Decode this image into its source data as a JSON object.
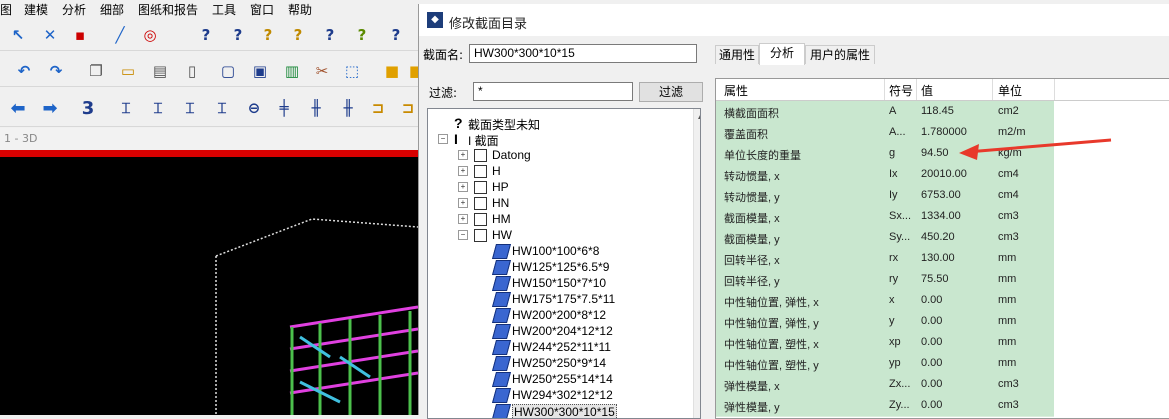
{
  "app": {
    "menu": [
      "图",
      "建模",
      "分析",
      "细部",
      "图纸和报告",
      "工具",
      "窗口",
      "帮助"
    ],
    "viewport_title": "1 - 3D"
  },
  "dialog": {
    "title": "修改截面目录",
    "section_name_label": "截面名:",
    "section_name_value": "HW300*300*10*15",
    "filter_label": "过滤:",
    "filter_value": "*",
    "filter_button": "过滤",
    "tabs": [
      "通用性",
      "分析",
      "用户的属性"
    ],
    "active_tab": "分析",
    "tree": [
      {
        "label": "截面类型未知",
        "level": 0,
        "icon": "question-icon"
      },
      {
        "label": "I 截面",
        "level": 0,
        "icon": "i-beam-icon",
        "expanded": true
      },
      {
        "label": "Datong",
        "level": 1
      },
      {
        "label": "H",
        "level": 1
      },
      {
        "label": "HP",
        "level": 1
      },
      {
        "label": "HN",
        "level": 1
      },
      {
        "label": "HM",
        "level": 1
      },
      {
        "label": "HW",
        "level": 1,
        "expanded": true
      },
      {
        "label": "HW100*100*6*8",
        "level": 2
      },
      {
        "label": "HW125*125*6.5*9",
        "level": 2
      },
      {
        "label": "HW150*150*7*10",
        "level": 2
      },
      {
        "label": "HW175*175*7.5*11",
        "level": 2
      },
      {
        "label": "HW200*200*8*12",
        "level": 2
      },
      {
        "label": "HW200*204*12*12",
        "level": 2
      },
      {
        "label": "HW244*252*11*11",
        "level": 2
      },
      {
        "label": "HW250*250*9*14",
        "level": 2
      },
      {
        "label": "HW250*255*14*14",
        "level": 2
      },
      {
        "label": "HW294*302*12*12",
        "level": 2
      },
      {
        "label": "HW300*300*10*15",
        "level": 2,
        "selected": true
      }
    ],
    "grid_headers": [
      "属性",
      "符号",
      "值",
      "单位"
    ],
    "grid_rows": [
      {
        "prop": "横截面面积",
        "sym": "A",
        "val": "118.45",
        "unit": "cm2"
      },
      {
        "prop": "覆盖面积",
        "sym": "A...",
        "val": "1.780000",
        "unit": "m2/m"
      },
      {
        "prop": "单位长度的重量",
        "sym": "g",
        "val": "94.50",
        "unit": "kg/m"
      },
      {
        "prop": "转动惯量, x",
        "sym": "Ix",
        "val": "20010.00",
        "unit": "cm4"
      },
      {
        "prop": "转动惯量, y",
        "sym": "Iy",
        "val": "6753.00",
        "unit": "cm4"
      },
      {
        "prop": "截面模量, x",
        "sym": "Sx...",
        "val": "1334.00",
        "unit": "cm3"
      },
      {
        "prop": "截面模量, y",
        "sym": "Sy...",
        "val": "450.20",
        "unit": "cm3"
      },
      {
        "prop": "回转半径, x",
        "sym": "rx",
        "val": "130.00",
        "unit": "mm"
      },
      {
        "prop": "回转半径, y",
        "sym": "ry",
        "val": "75.50",
        "unit": "mm"
      },
      {
        "prop": "中性轴位置, 弹性, x",
        "sym": "x",
        "val": "0.00",
        "unit": "mm"
      },
      {
        "prop": "中性轴位置, 弹性, y",
        "sym": "y",
        "val": "0.00",
        "unit": "mm"
      },
      {
        "prop": "中性轴位置, 塑性, x",
        "sym": "xp",
        "val": "0.00",
        "unit": "mm"
      },
      {
        "prop": "中性轴位置, 塑性, y",
        "sym": "yp",
        "val": "0.00",
        "unit": "mm"
      },
      {
        "prop": "弹性模量, x",
        "sym": "Zx...",
        "val": "0.00",
        "unit": "cm3"
      },
      {
        "prop": "弹性模量, y",
        "sym": "Zy...",
        "val": "0.00",
        "unit": "cm3"
      }
    ],
    "colors": {
      "grid_row": "#c9e7cf",
      "arrow": "#e8392b"
    }
  }
}
